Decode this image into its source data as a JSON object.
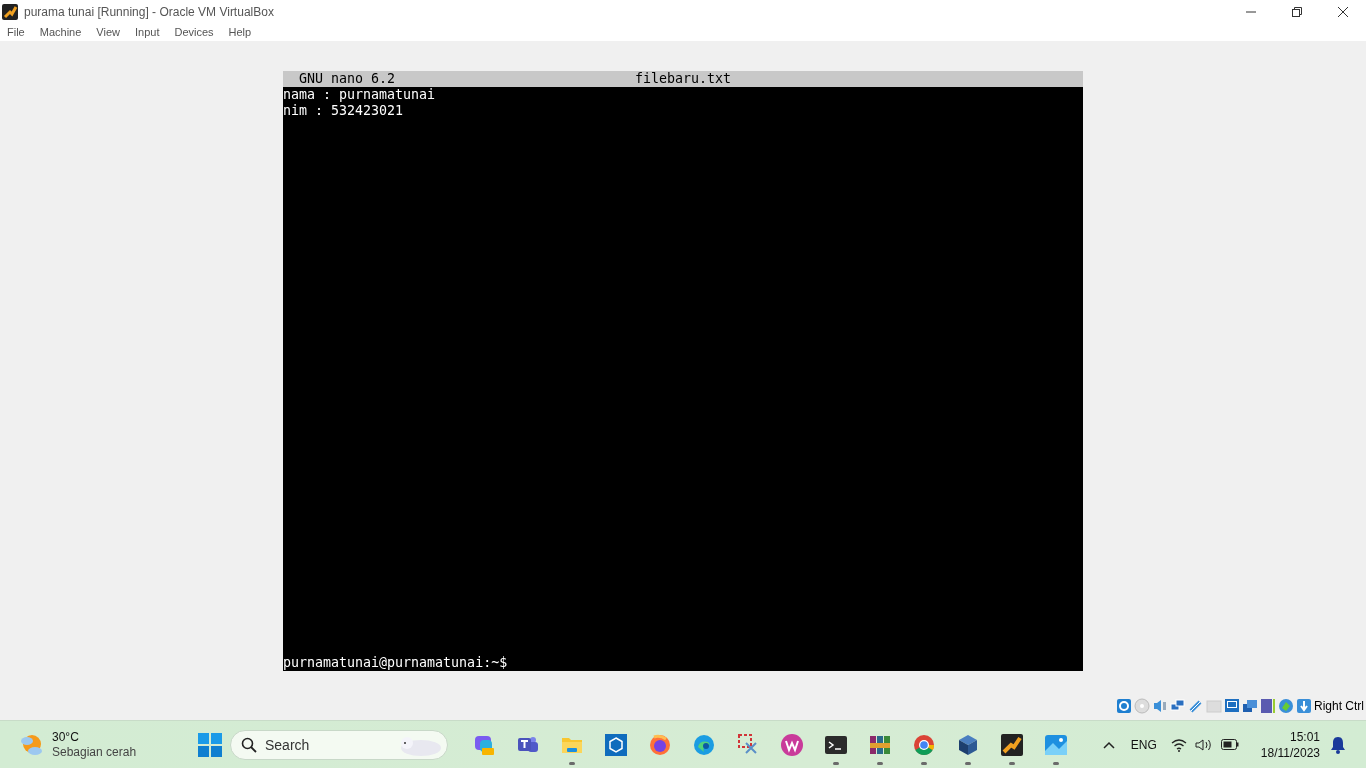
{
  "window": {
    "title": "purama tunai [Running] - Oracle VM VirtualBox"
  },
  "menu": [
    "File",
    "Machine",
    "View",
    "Input",
    "Devices",
    "Help"
  ],
  "nano": {
    "version": "GNU nano 6.2",
    "filename": "filebaru.txt",
    "lines": [
      "nama : purnamatunai",
      "nim : 532423021"
    ],
    "prompt": "purnamatunai@purnamatunai:~$"
  },
  "status_bar": {
    "host_key": "Right Ctrl"
  },
  "taskbar": {
    "weather": {
      "temperature": "30°C",
      "condition": "Sebagian cerah"
    },
    "search": {
      "placeholder": "Search"
    },
    "apps": [
      {
        "running": false
      },
      {
        "running": false
      },
      {
        "running": true
      },
      {
        "running": false
      },
      {
        "running": false
      },
      {
        "running": false
      },
      {
        "running": false
      },
      {
        "running": false
      },
      {
        "running": true
      },
      {
        "running": true
      },
      {
        "running": true
      },
      {
        "running": true
      },
      {
        "running": true
      },
      {
        "running": true
      }
    ],
    "tray": {
      "language": "ENG",
      "time": "15:01",
      "date": "18/11/2023"
    }
  }
}
